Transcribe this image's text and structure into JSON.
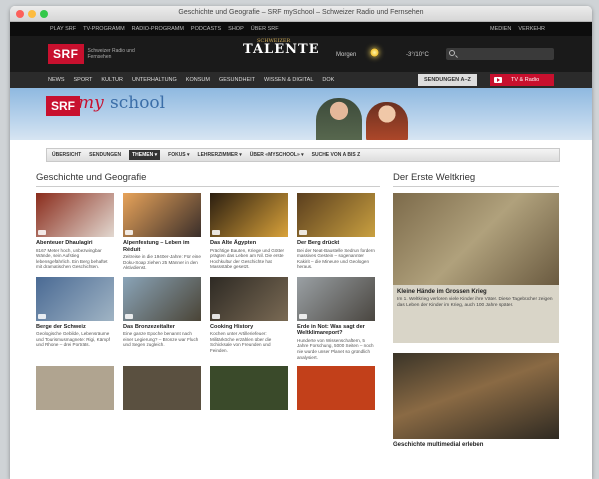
{
  "window": {
    "title": "Geschichte und Geografie – SRF mySchool – Schweizer Radio und Fernsehen"
  },
  "topbar": {
    "items": [
      "PLAY SRF",
      "TV-PROGRAMM",
      "RADIO-PROGRAMM",
      "PODCASTS",
      "SHOP",
      "ÜBER SRF"
    ],
    "right": [
      "MEDIEN",
      "VERKEHR"
    ]
  },
  "header": {
    "logo": "SRF",
    "logo_sub": "Schweizer Radio und Fernsehen",
    "talente_small": "SCHWEIZER",
    "talente": "TALENTE",
    "weather_day": "Morgen",
    "weather_icon": "sun-icon",
    "temp": "-3°/10°C"
  },
  "nav": {
    "items": [
      "NEWS",
      "SPORT",
      "KULTUR",
      "UNTERHALTUNG",
      "KONSUM",
      "GESUNDHEIT",
      "WISSEN & DIGITAL",
      "DOK"
    ],
    "az": "SENDUNGEN A–Z",
    "tv": "TV & Radio"
  },
  "hero": {
    "logo": "SRF",
    "my": "my",
    "school": "school"
  },
  "subnav": [
    "ÜBERSICHT",
    "SENDUNGEN",
    "THEMEN ▾",
    "FOKUS ▾",
    "LEHRERZIMMER ▾",
    "ÜBER «MYSCHOOL» ▾",
    "SUCHE VON A BIS Z"
  ],
  "main": {
    "title": "Geschichte und Geografie",
    "cards": [
      {
        "title": "Abenteuer Dhaulagiri",
        "desc": "8167 Meter hoch, unbezwingbar Wände, sein Aufstieg lebensgefährlich. Ein Berg behaftet mit dramatischen Geschichten.",
        "color1": "#8a2c1c",
        "color2": "#e2d8d0"
      },
      {
        "title": "Alpenfestung – Leben im Réduit",
        "desc": "Zeitreise in die 1940er-Jahre: Für eine Doku-Soap ziehen 25 Männer in den Aktivdienst.",
        "color1": "#e7a35a",
        "color2": "#3a2e2a"
      },
      {
        "title": "Das Alte Ägypten",
        "desc": "Prächtige Bauten, Kriege und Götter prägten das Leben am Nil. Die erste Hochkultur der Geschichte hat Massstäbe gesetzt.",
        "color1": "#2b1e10",
        "color2": "#d9a23a"
      },
      {
        "title": "Der Berg drückt",
        "desc": "Bei der Neat-Baustelle Sedrun fordern massives Gestein – sogenannter Kakirit – die Mineure und Geologen heraus.",
        "color1": "#5a3e1e",
        "color2": "#c9a040"
      },
      {
        "title": "Berge der Schweiz",
        "desc": "Geologische Gebilde, Lebensräume und Tourismusmagnete: Rigi, Kämpf und Rhone – drei Porträts.",
        "color1": "#4a6a94",
        "color2": "#a0b4c4"
      },
      {
        "title": "Das Bronzezeitalter",
        "desc": "Eine ganze Epoche benannt nach einer Legierung? – Bronze war Fluch und Segen zugleich.",
        "color1": "#8aa4b8",
        "color2": "#4a4436"
      },
      {
        "title": "Cooking History",
        "desc": "Kochen unter Artilleriefeuer: Militärköche erzählen über die Schicksale von Freunden und Feinden.",
        "color1": "#2e2a24",
        "color2": "#7a6a54"
      },
      {
        "title": "Erde in Not: Was sagt der Weltklimareport?",
        "desc": "Hunderte von Wissenschaftern, 5 Jahre Forschung, 5000 Seiten – noch nie wurde unser Planet so gründlich analysiert.",
        "color1": "#9aa0a4",
        "color2": "#4a4640"
      }
    ],
    "row3_colors": [
      "#b0a490",
      "#5a5040",
      "#3a4a2a",
      "#c2401a"
    ]
  },
  "aside": {
    "title": "Der Erste Weltkrieg",
    "caption_title": "Kleine Hände im Grossen Krieg",
    "caption_desc": "Im 1. Weltkrieg verloren viele Kinder ihre Väter. Diese Tagebücher zeigen das Leben der Kinder im Krieg, auch 100 Jahre später.",
    "title2": "Geschichte multimedial erleben"
  }
}
